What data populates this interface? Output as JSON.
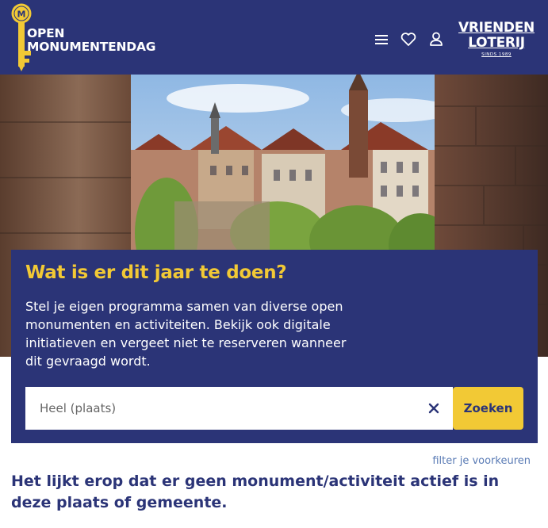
{
  "header": {
    "logo_line1": "OPEN",
    "logo_line2": "MONUMENTENDAG",
    "key_letter": "M",
    "partner_line1": "VRIENDEN",
    "partner_line2": "LOTERIJ",
    "partner_since": "SINDS 1989",
    "icons": [
      "menu-icon",
      "heart-icon",
      "user-icon"
    ]
  },
  "colors": {
    "brand_blue": "#2b3477",
    "accent_yellow": "#f2c935",
    "link_blue": "#5a7bb5"
  },
  "card": {
    "title": "Wat is er dit jaar te doen?",
    "text": "Stel je eigen programma samen van diverse open monumenten en activiteiten. Bekijk ook digitale initiatieven en vergeet niet te reserveren wanneer dit gevraagd wordt.",
    "search_placeholder": "Heel (plaats)",
    "search_button": "Zoeken"
  },
  "filter_link": "filter je voorkeuren",
  "no_result": "Het lijkt erop dat er geen monument/activiteit actief is in deze plaats of gemeente."
}
